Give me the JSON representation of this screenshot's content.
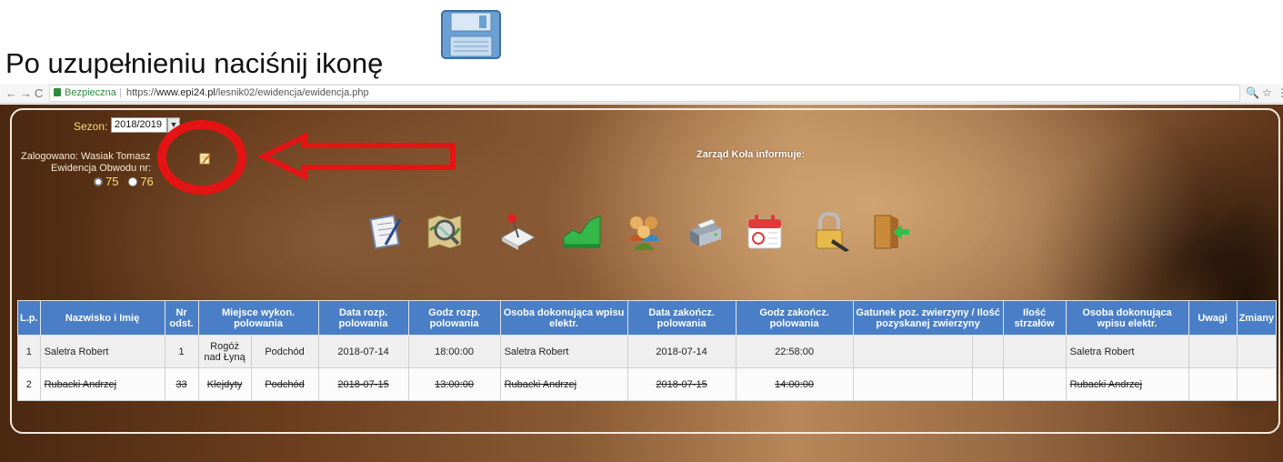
{
  "caption": "Po uzupełnieniu naciśnij ikonę",
  "browser": {
    "back": "←",
    "forward": "→",
    "reload": "C",
    "secure_label": "Bezpieczna",
    "url_prefix": "https://",
    "url_host": "www.epi24.pl",
    "url_path": "/lesnik02/ewidencja/ewidencja.php",
    "zoom_icon": "🔍",
    "star_icon": "☆",
    "menu_icon": "⋮"
  },
  "header": {
    "season_label": "Sezon:",
    "season_value": "2018/2019",
    "logged_in": "Zalogowano:  Wasiak Tomasz",
    "evidence_label": "Ewidencja Obwodu nr:",
    "district_options": [
      "75",
      "76"
    ],
    "selected_district": "75",
    "notice": "Zarząd Koła informuje:"
  },
  "toolbar_icons": [
    "notepad-icon",
    "map-magnifier-icon",
    "pin-notebook-icon",
    "terrain-chart-icon",
    "users-group-icon",
    "printer-icon",
    "calendar-icon",
    "padlock-icon",
    "exit-door-icon"
  ],
  "table": {
    "headers": [
      "L.p.",
      "Nazwisko i Imię",
      "Nr odst.",
      "Miejsce wykon. polowania",
      "Data rozp. polowania",
      "Godz rozp. polowania",
      "Osoba dokonująca wpisu elektr.",
      "Data zakończ. polowania",
      "Godz zakończ. polowania",
      "Gatunek poz. zwierzyny / Ilość pozyskanej zwierzyny",
      "Ilość strzałów",
      "Osoba dokonująca wpisu elektr.",
      "Uwagi",
      "Zmiany"
    ],
    "rows": [
      {
        "lp": "1",
        "name": "Saletra Robert",
        "nr": "1",
        "place1": "Rogóż nad Łyną",
        "place2": "Podchód",
        "date_start": "2018-07-14",
        "time_start": "18:00:00",
        "entry_person": "Saletra Robert",
        "date_end": "2018-07-14",
        "time_end": "22:58:00",
        "species": "",
        "count": "",
        "shots": "",
        "entry_person2": "Saletra Robert",
        "notes": "",
        "changes": ""
      },
      {
        "lp": "2",
        "name": "Rubacki Andrzej",
        "nr": "33",
        "place1": "Klejdyty",
        "place2": "Podchód",
        "date_start": "2018-07-15",
        "time_start": "13:00:00",
        "entry_person": "Rubacki Andrzej",
        "date_end": "2018-07-15",
        "time_end": "14:00:00",
        "species": "",
        "count": "",
        "shots": "",
        "entry_person2": "Rubacki Andrzej",
        "notes": "",
        "changes": ""
      }
    ]
  },
  "colors": {
    "header_blue": "#4a7fc7",
    "annotation_red": "#e41414",
    "season_yellow": "#f5e070"
  }
}
